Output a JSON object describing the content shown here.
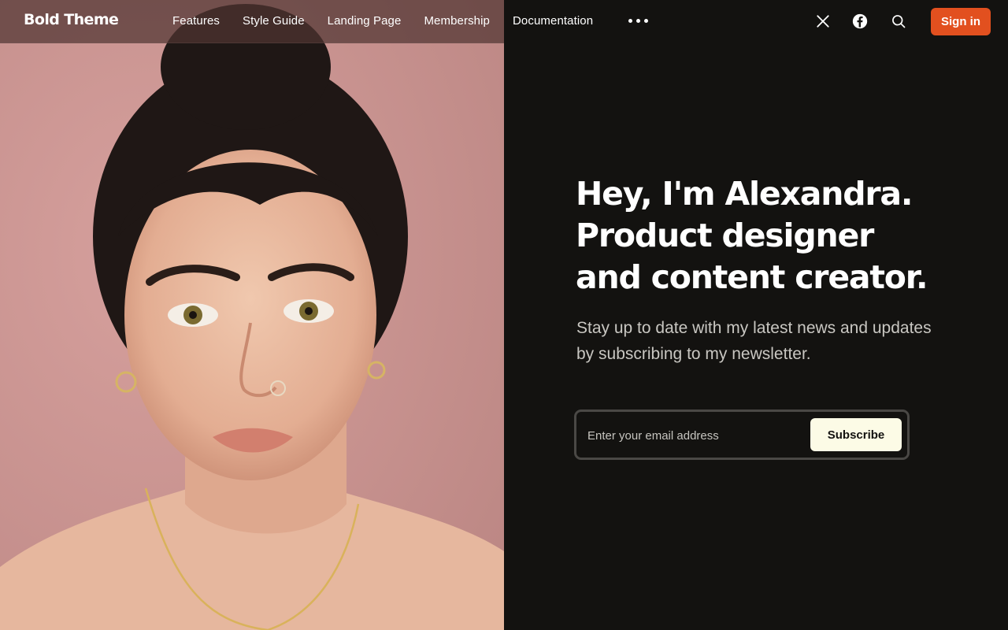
{
  "header": {
    "logo": "Bold Theme",
    "nav": [
      "Features",
      "Style Guide",
      "Landing Page",
      "Membership",
      "Documentation"
    ],
    "more_icon": "ellipsis-icon",
    "social_icons": [
      "x-twitter-icon",
      "facebook-icon"
    ],
    "search_icon": "search-icon",
    "signin_label": "Sign in",
    "signin_color": "#e2501f"
  },
  "hero": {
    "image_alt": "portrait photo",
    "headline": [
      "Hey, I'm Alexandra.",
      "Product designer",
      "and content creator."
    ],
    "subtext": "Stay up to date with my latest news and updates by subscribing to my newsletter.",
    "email_placeholder": "Enter your email address",
    "subscribe_label": "Subscribe"
  },
  "colors": {
    "background": "#131210",
    "image_backdrop": "#c99593",
    "accent": "#e2501f",
    "subscribe_button": "#fcfbe6"
  }
}
